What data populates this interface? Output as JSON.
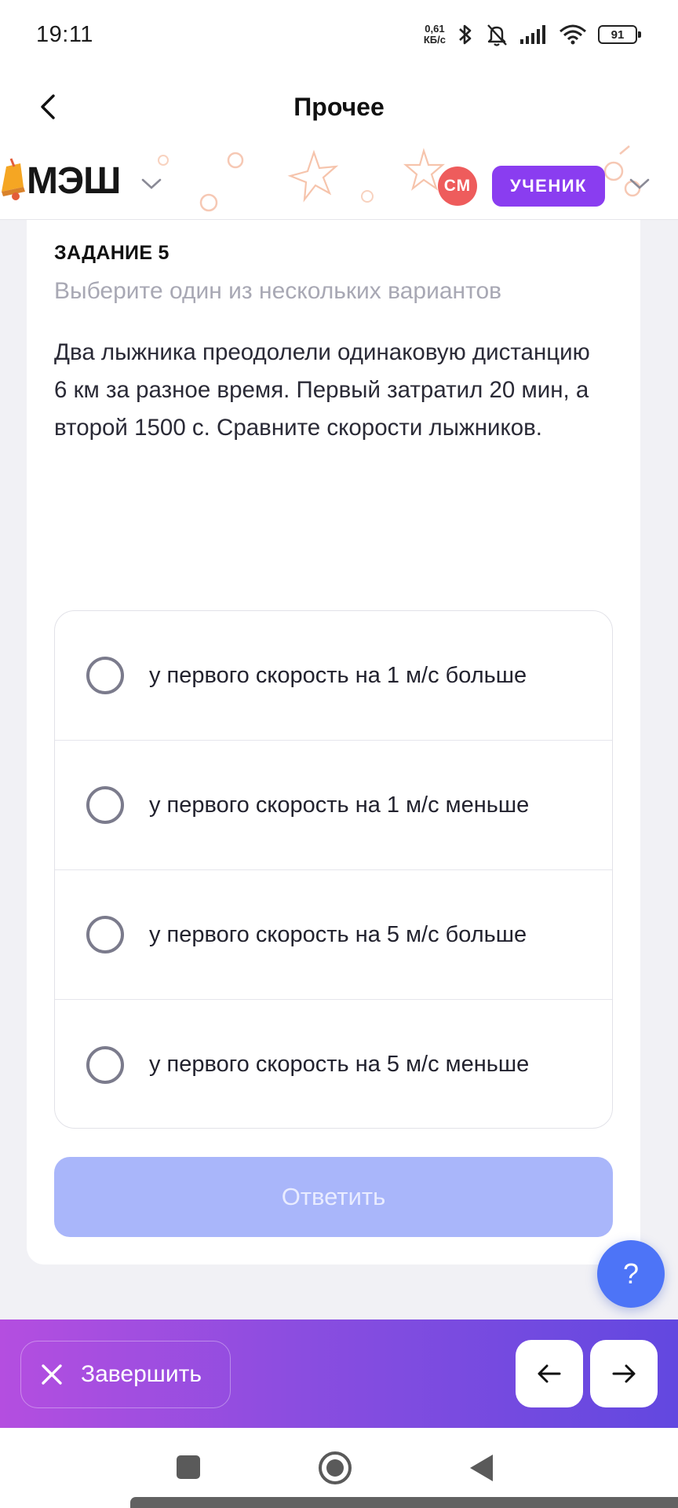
{
  "status_bar": {
    "time": "19:11",
    "net_speed_value": "0,61",
    "net_speed_unit": "КБ/с",
    "battery": "91"
  },
  "title_bar": {
    "title": "Прочее"
  },
  "app_header": {
    "logo": "МЭШ",
    "avatar_initials": "СМ",
    "role": "УЧЕНИК"
  },
  "task": {
    "label": "ЗАДАНИЕ 5",
    "hint": "Выберите один из нескольких вариантов",
    "text": "Два лыжника преодолели одинаковую дистанцию 6 км за разное время. Первый затратил 20 мин, а второй 1500 с. Сравните скорости лыжников.",
    "options": [
      {
        "label": "у первого скорость на 1 м/с больше",
        "selected": false
      },
      {
        "label": "у первого скорость на 1 м/с меньше",
        "selected": false
      },
      {
        "label": "у первого скорость на 5 м/с больше",
        "selected": false
      },
      {
        "label": "у первого скорость на 5 м/с меньше",
        "selected": false
      }
    ],
    "submit_label": "Ответить"
  },
  "help": {
    "label": "?"
  },
  "bottom_bar": {
    "finish_label": "Завершить",
    "prev_icon": "arrow-left-icon",
    "next_icon": "arrow-right-icon"
  },
  "colors": {
    "accent": "#8a3df0",
    "avatar": "#ee5c5c",
    "submit_disabled": "#a9b6fa",
    "help_fab": "#4d74f7",
    "bottom_gradient_start": "#b44ee0",
    "bottom_gradient_end": "#6248e0"
  }
}
